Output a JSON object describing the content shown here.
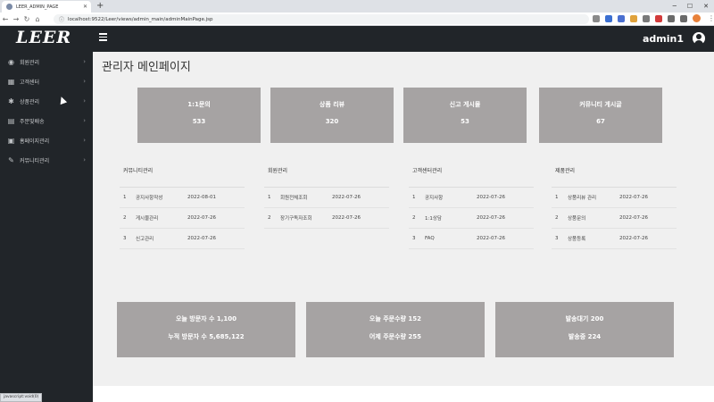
{
  "browser": {
    "tab_title": "LEER_ADMIN_PAGE",
    "url": "localhost:9522/Leer/views/admin_main/adminMainPage.jsp",
    "status_text": "javascript:void(0)"
  },
  "header": {
    "logo": "LEER",
    "user": "admin1"
  },
  "sidebar": {
    "items": [
      {
        "label": "회원관리",
        "icon": "user-circle-icon"
      },
      {
        "label": "고객센터",
        "icon": "table-icon"
      },
      {
        "label": "상품관리",
        "icon": "tag-icon"
      },
      {
        "label": "주문및배송",
        "icon": "list-icon"
      },
      {
        "label": "홈페이지관리",
        "icon": "image-icon"
      },
      {
        "label": "커뮤니티관리",
        "icon": "pen-icon"
      }
    ]
  },
  "main": {
    "title": "관리자 메인페이지",
    "cards": [
      {
        "label": "1:1문의",
        "value": "533"
      },
      {
        "label": "상품 리뷰",
        "value": "320"
      },
      {
        "label": "신고 게시물",
        "value": "53"
      },
      {
        "label": "커뮤니티 게시글",
        "value": "67"
      }
    ],
    "sections": [
      {
        "title": "커뮤니티관리",
        "rows": [
          {
            "no": "1",
            "name": "공지사항작성",
            "date": "2022-08-01"
          },
          {
            "no": "2",
            "name": "게시물관리",
            "date": "2022-07-26"
          },
          {
            "no": "3",
            "name": "신고관리",
            "date": "2022-07-26"
          }
        ]
      },
      {
        "title": "회원관리",
        "rows": [
          {
            "no": "1",
            "name": "회원전체조회",
            "date": "2022-07-26"
          },
          {
            "no": "2",
            "name": "장기구독자조회",
            "date": "2022-07-26"
          }
        ]
      },
      {
        "title": "고객센터관리",
        "rows": [
          {
            "no": "1",
            "name": "공지사항",
            "date": "2022-07-26"
          },
          {
            "no": "2",
            "name": "1:1상담",
            "date": "2022-07-26"
          },
          {
            "no": "3",
            "name": "FAQ",
            "date": "2022-07-26"
          }
        ]
      },
      {
        "title": "제품관리",
        "rows": [
          {
            "no": "1",
            "name": "상품리뷰 관리",
            "date": "2022-07-26"
          },
          {
            "no": "2",
            "name": "상품문의",
            "date": "2022-07-26"
          },
          {
            "no": "3",
            "name": "상품등록",
            "date": "2022-07-26"
          }
        ]
      }
    ],
    "stats": [
      {
        "line1": "오늘 방문자 수 1,100",
        "line2": "누적 방문자 수 5,685,122"
      },
      {
        "line1": "오늘 주문수량 152",
        "line2": "어제 주문수량 255"
      },
      {
        "line1": "발송대기 200",
        "line2": "발송중 224"
      }
    ]
  }
}
